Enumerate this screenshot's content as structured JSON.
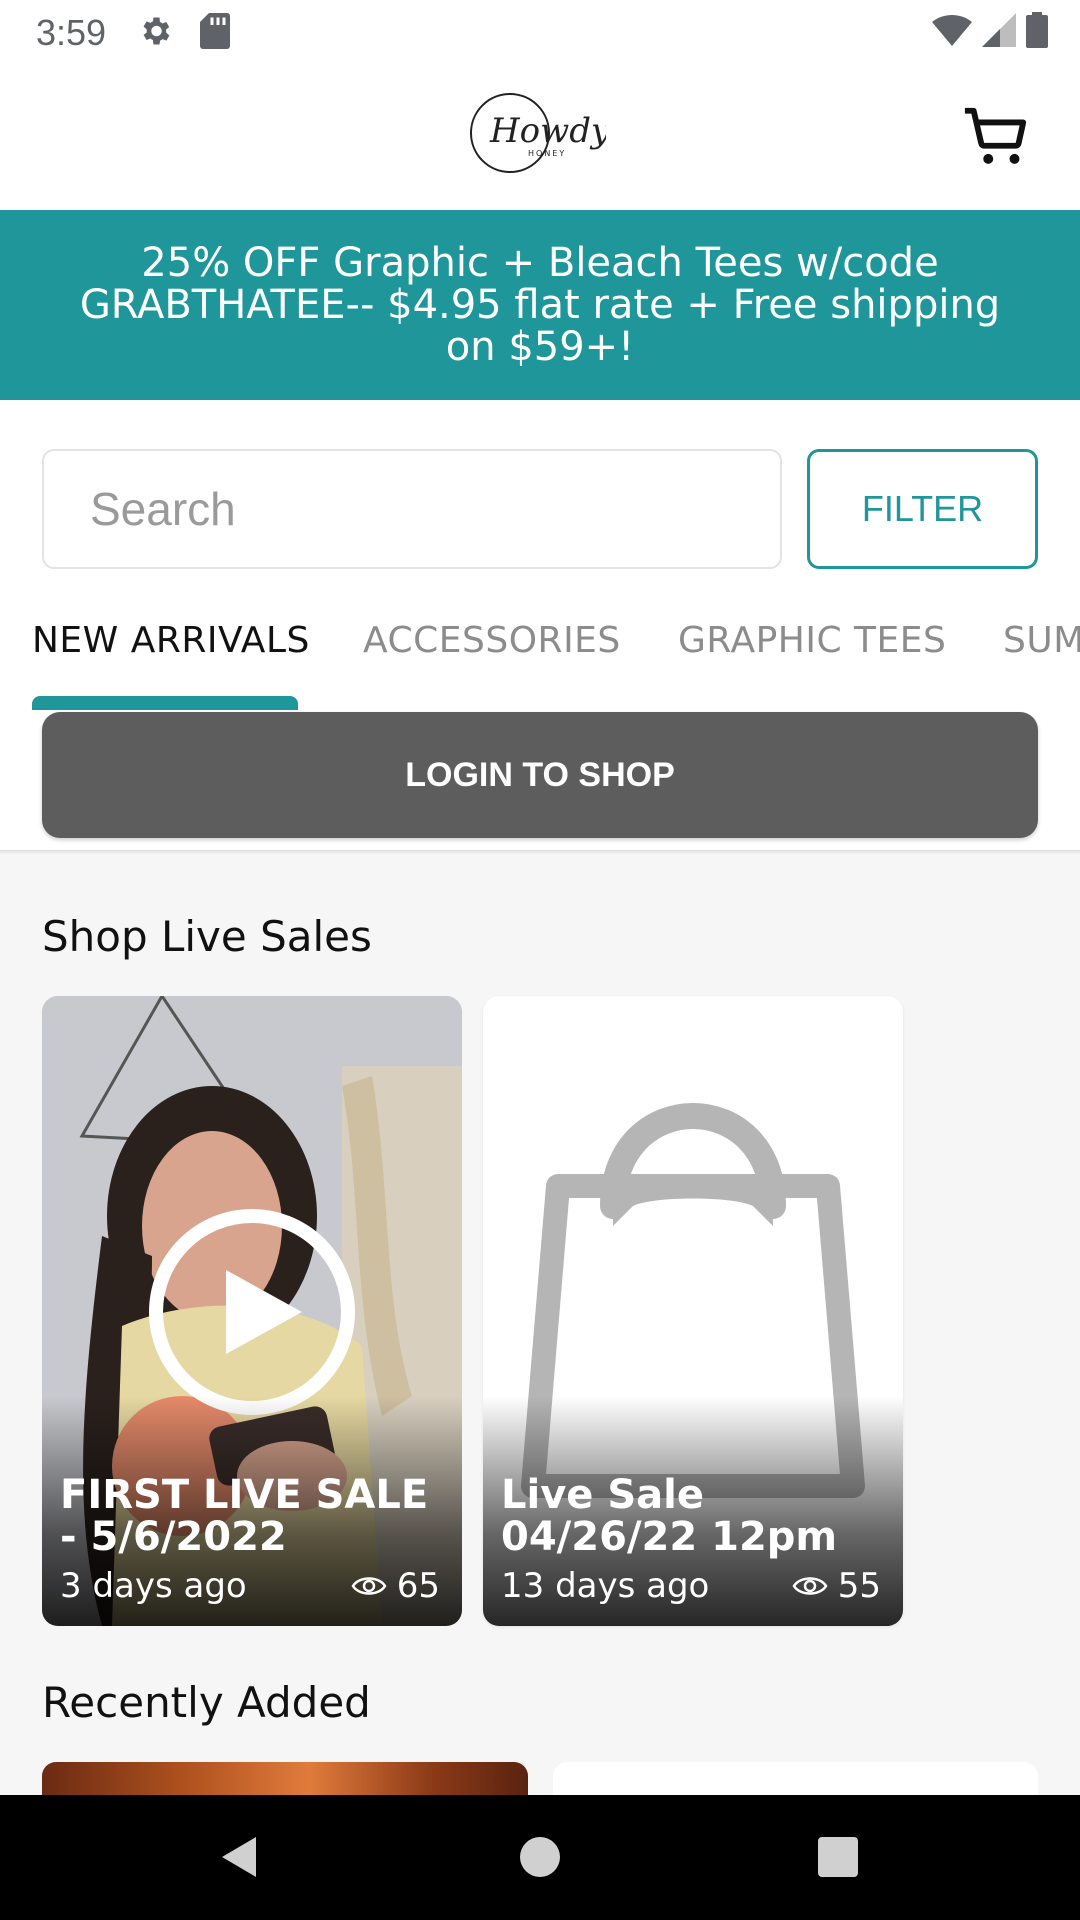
{
  "status_bar": {
    "time": "3:59",
    "icons": [
      "gear-icon",
      "sd-card-icon",
      "wifi-icon",
      "signal-icon",
      "battery-icon"
    ]
  },
  "header": {
    "logo_text": "Howdy",
    "logo_subtext": "HONEY",
    "cart_icon": "cart-icon"
  },
  "promo": {
    "text": "25% OFF Graphic + Bleach Tees w/code GRABTHATEE-- $4.95 flat rate + Free shipping on $59+!",
    "background": "#1f9699"
  },
  "search": {
    "placeholder": "Search",
    "value": ""
  },
  "filter": {
    "label": "FILTER"
  },
  "tabs": [
    {
      "label": "NEW ARRIVALS",
      "active": true
    },
    {
      "label": "ACCESSORIES",
      "active": false
    },
    {
      "label": "GRAPHIC TEES",
      "active": false
    },
    {
      "label": "SUM",
      "active": false
    }
  ],
  "login": {
    "label": "LOGIN TO SHOP"
  },
  "live_sales": {
    "title": "Shop Live Sales",
    "cards": [
      {
        "title": "FIRST LIVE SALE - 5/6/2022",
        "age": "3 days ago",
        "views": "65"
      },
      {
        "title": "Live Sale 04/26/22 12pm",
        "age": "13 days ago",
        "views": "55"
      }
    ]
  },
  "recently_added": {
    "title": "Recently Added"
  },
  "colors": {
    "accent": "#1f9699",
    "login_button": "#5d5d5d"
  }
}
